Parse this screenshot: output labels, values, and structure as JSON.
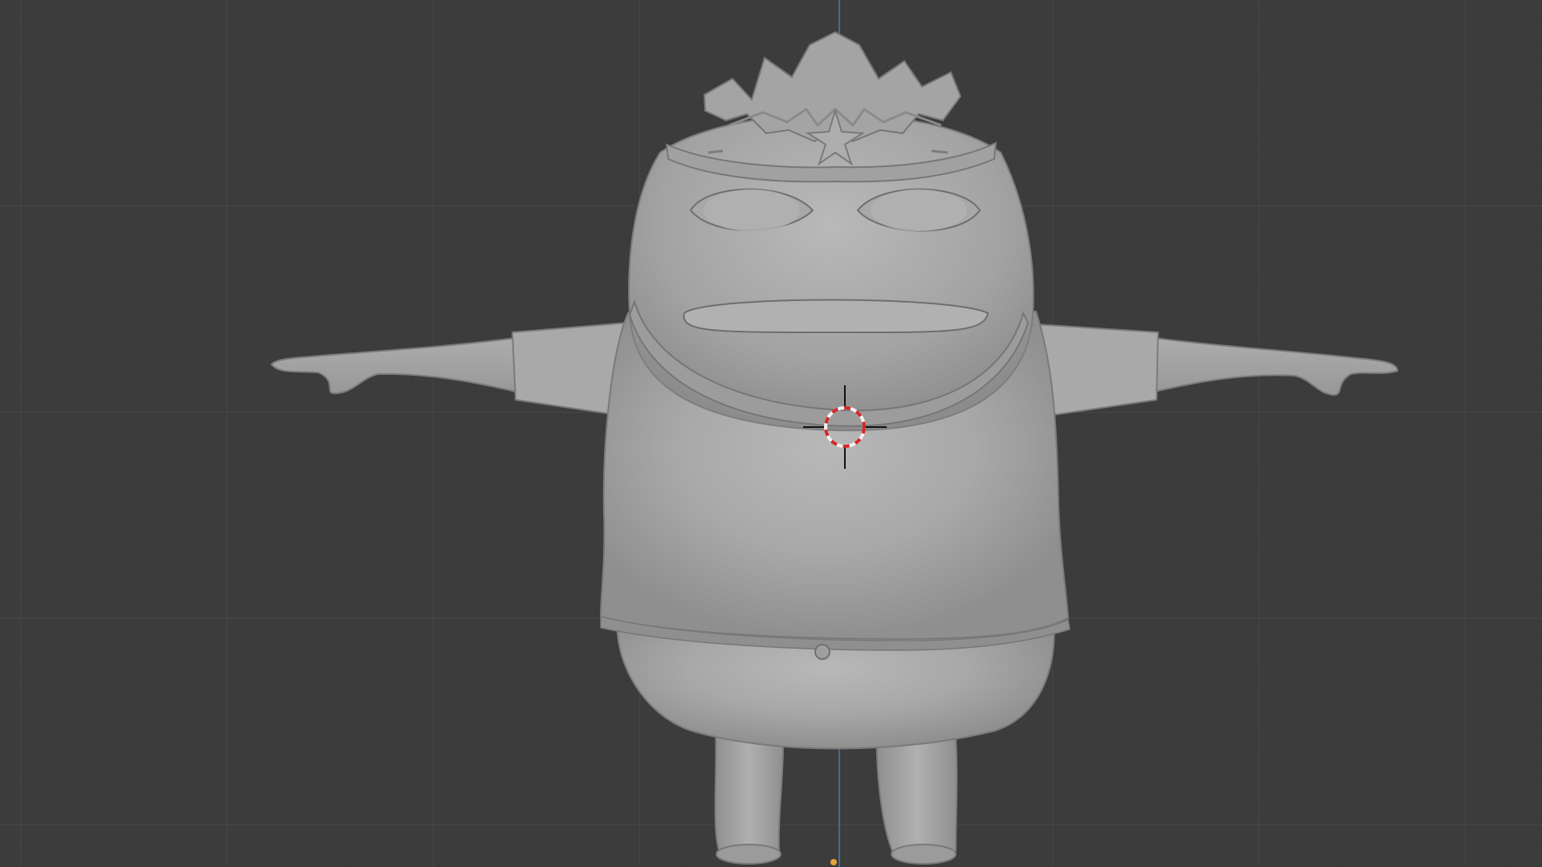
{
  "viewport": {
    "background_color": "#3c3c3c",
    "axis_color": "#3c6fa3",
    "model_color": "#a7a7a7",
    "cursor_ring_colors": [
      "#d72626",
      "#f2f2f2"
    ],
    "model_name_icon": "character-mesh",
    "cursor_icon": "3d-cursor-icon"
  }
}
